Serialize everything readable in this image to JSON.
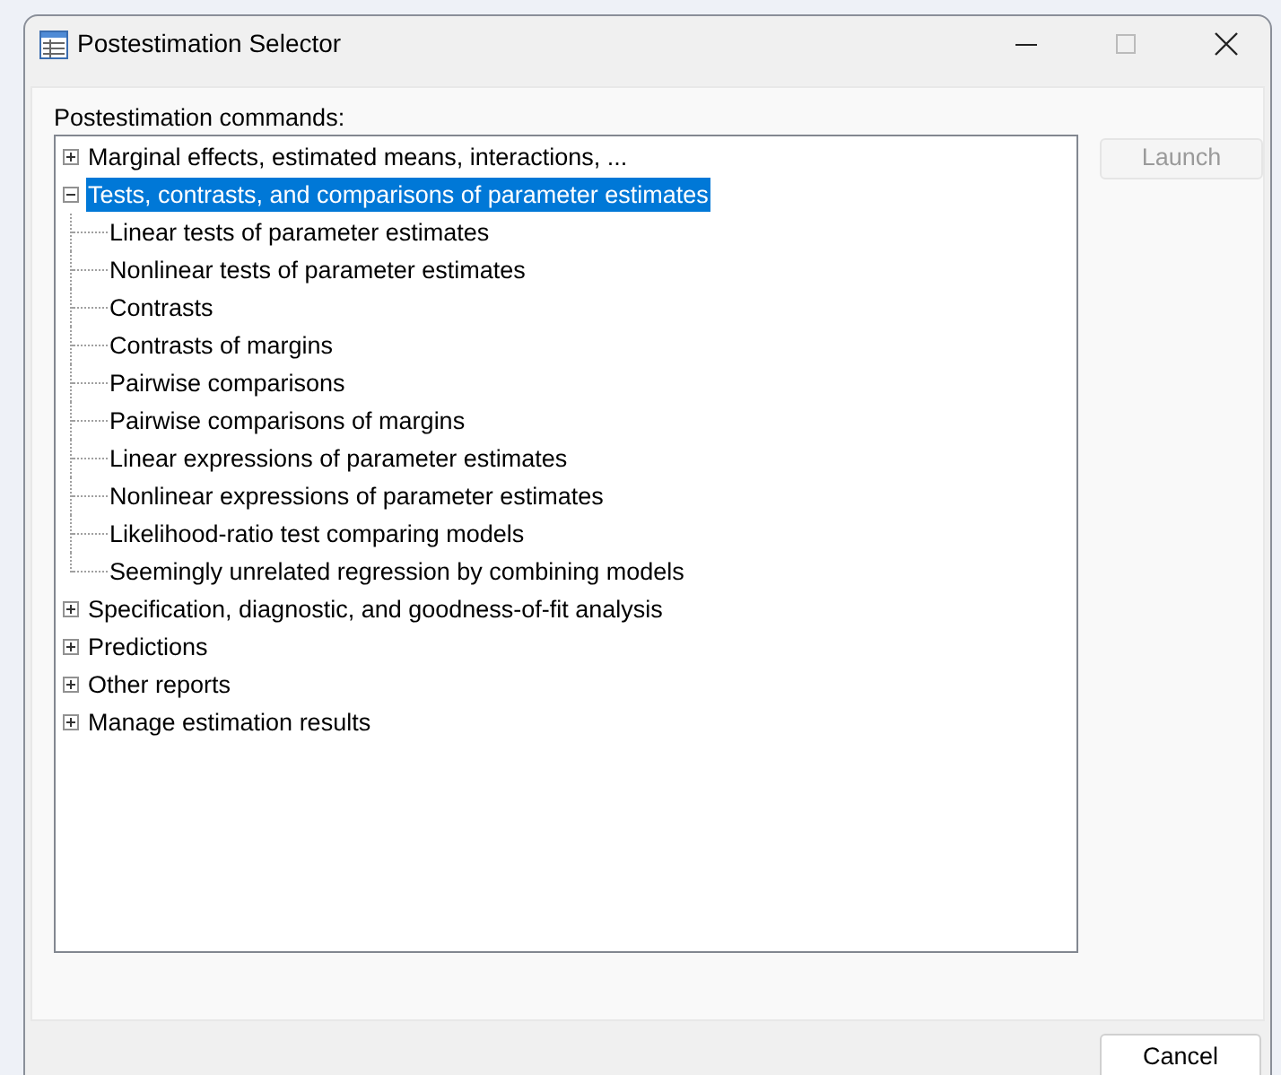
{
  "window": {
    "title": "Postestimation Selector"
  },
  "commands_label": "Postestimation commands:",
  "tree": [
    {
      "label": "Marginal effects, estimated means, interactions, ...",
      "expanded": false,
      "selected": false
    },
    {
      "label": "Tests, contrasts, and comparisons of parameter estimates",
      "expanded": true,
      "selected": true,
      "children": [
        {
          "label": "Linear tests of parameter estimates",
          "selected": false
        },
        {
          "label": "Nonlinear tests of parameter estimates",
          "selected": false
        },
        {
          "label": "Contrasts",
          "selected": false
        },
        {
          "label": "Contrasts of margins",
          "selected": false
        },
        {
          "label": "Pairwise comparisons",
          "selected": false
        },
        {
          "label": "Pairwise comparisons of margins",
          "selected": false
        },
        {
          "label": "Linear expressions of parameter estimates",
          "selected": false
        },
        {
          "label": "Nonlinear expressions of parameter estimates",
          "selected": false
        },
        {
          "label": "Likelihood-ratio test comparing models",
          "selected": false
        },
        {
          "label": "Seemingly unrelated regression by combining models",
          "selected": false
        }
      ]
    },
    {
      "label": "Specification, diagnostic, and goodness-of-fit analysis",
      "expanded": false,
      "selected": false
    },
    {
      "label": "Predictions",
      "expanded": false,
      "selected": false
    },
    {
      "label": "Other reports",
      "expanded": false,
      "selected": false
    },
    {
      "label": "Manage estimation results",
      "expanded": false,
      "selected": false
    }
  ],
  "launch_button": {
    "label": "Launch",
    "disabled": true
  },
  "cancel_button": {
    "label": "Cancel"
  }
}
